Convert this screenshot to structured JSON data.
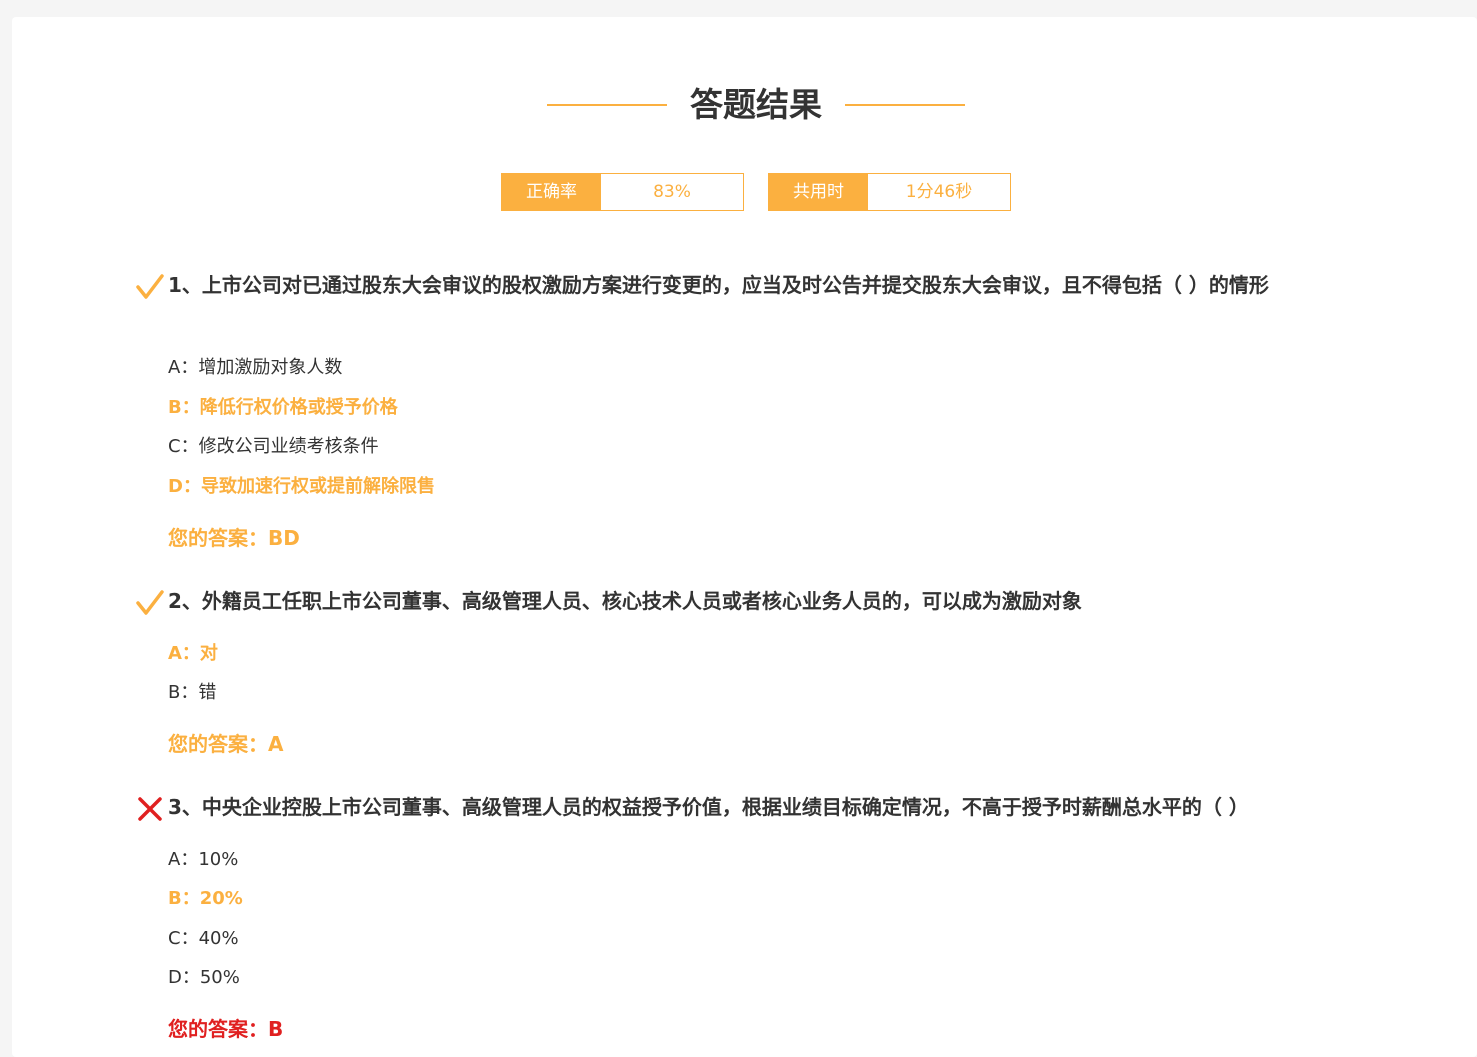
{
  "header": {
    "title": "答题结果"
  },
  "stats": {
    "accuracy_label": "正确率",
    "accuracy_value": "83%",
    "time_label": "共用时",
    "time_value": "1分46秒"
  },
  "colors": {
    "accent": "#fbb040",
    "wrong": "#e02020",
    "text": "#333333"
  },
  "questions": [
    {
      "num": "1、",
      "text": "上市公司对已通过股东大会审议的股权激励方案进行变更的，应当及时公告并提交股东大会审议，且不得包括（ ）的情形",
      "status_icon": "check-icon",
      "options": [
        {
          "text": "A：增加激励对象人数",
          "correct": false
        },
        {
          "text": "B：降低行权价格或授予价格",
          "correct": true
        },
        {
          "text": "C：修改公司业绩考核条件",
          "correct": false
        },
        {
          "text": "D：导致加速行权或提前解除限售",
          "correct": true
        }
      ],
      "answer": "您的答案：BD"
    },
    {
      "num": "2、",
      "text": "外籍员工任职上市公司董事、高级管理人员、核心技术人员或者核心业务人员的，可以成为激励对象",
      "status_icon": "check-icon",
      "options": [
        {
          "text": "A：对",
          "correct": true
        },
        {
          "text": "B：错",
          "correct": false
        }
      ],
      "answer": "您的答案：A"
    },
    {
      "num": "3、",
      "text": "中央企业控股上市公司董事、高级管理人员的权益授予价值，根据业绩目标确定情况，不高于授予时薪酬总水平的（ ）",
      "status_icon": "cross-icon",
      "options": [
        {
          "text": "A：10%",
          "correct": false
        },
        {
          "text": "B：20%",
          "correct": true
        },
        {
          "text": "C：40%",
          "correct": false
        },
        {
          "text": "D：50%",
          "correct": false
        }
      ],
      "answer": "您的答案：B"
    }
  ]
}
